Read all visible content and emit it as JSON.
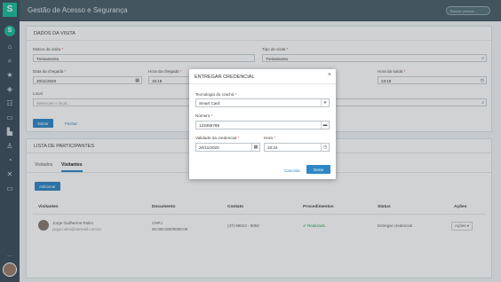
{
  "app": {
    "title": "Gestão de Acesso e Segurança",
    "search_placeholder": "Buscar pessoa..."
  },
  "visit": {
    "header": "Dados da visita",
    "motivo_label": "Motivo da visita",
    "motivo_value": "Treinamento",
    "tipo_label": "Tipo de visita",
    "tipo_value": "Treinamento",
    "data_chegada_label": "Data da chegada",
    "data_chegada_value": "20/11/2020",
    "hora_chegada_label": "Hora da chegada",
    "hora_chegada_value": "15:19",
    "hora_saida_label": "Hora da saída",
    "hora_saida_value": "23:19",
    "local_label": "Local",
    "local_placeholder": "Selecione o local...",
    "save_label": "Salvar",
    "close_label": "Fechar"
  },
  "participants": {
    "header": "Lista de participantes",
    "tabs": [
      "Visitados",
      "Visitantes"
    ],
    "add_label": "Adicionar",
    "columns": [
      "Visitantes",
      "Documento",
      "Contato",
      "Procedimentos",
      "Status",
      "Ações"
    ],
    "rows": [
      {
        "name": "Jorge Guilherme Rolim",
        "email": "jorge.rolim@sermeil.com.br",
        "doc_type": "CNPJ",
        "doc_number": "00.000.000/0000-00",
        "contact": "(47) 98913 - 8092",
        "procedure": "Realizado",
        "status": "Entregar credencial",
        "action": "Ações"
      }
    ]
  },
  "modal": {
    "title": "Entregar credencial",
    "tecnologia_label": "Tecnologia do crachá",
    "tecnologia_value": "Smart Card",
    "numero_label": "Número",
    "numero_value": "123456789",
    "validade_label": "Validade da credencial",
    "validade_value": "20/11/2020",
    "hora_label": "Hora",
    "hora_value": "23:24",
    "cancel_label": "Cancelar",
    "save_label": "Gerar"
  },
  "colors": {
    "accent": "#2f86c6",
    "brand": "#1abc9c",
    "success": "#27ae60",
    "required": "#e74c3c"
  }
}
